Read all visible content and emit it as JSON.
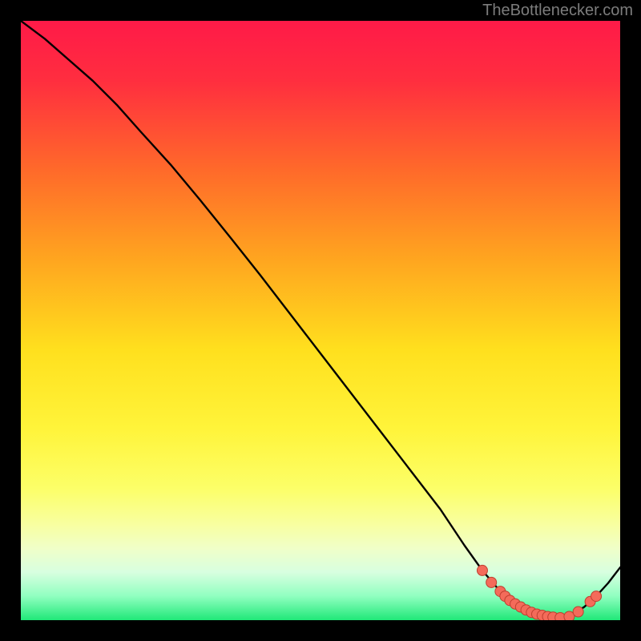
{
  "credit": "TheBottlenecker.com",
  "gradient_stops": [
    {
      "offset": 0,
      "color": "#ff1a48"
    },
    {
      "offset": 0.1,
      "color": "#ff2e3f"
    },
    {
      "offset": 0.25,
      "color": "#ff6a2a"
    },
    {
      "offset": 0.4,
      "color": "#ffa61f"
    },
    {
      "offset": 0.55,
      "color": "#ffe01e"
    },
    {
      "offset": 0.68,
      "color": "#fff43a"
    },
    {
      "offset": 0.78,
      "color": "#fcff68"
    },
    {
      "offset": 0.84,
      "color": "#f8ffa0"
    },
    {
      "offset": 0.88,
      "color": "#f0ffc8"
    },
    {
      "offset": 0.92,
      "color": "#d8ffe0"
    },
    {
      "offset": 0.96,
      "color": "#90ffc0"
    },
    {
      "offset": 1.0,
      "color": "#20e878"
    }
  ],
  "chart_data": {
    "type": "line",
    "title": "",
    "xlabel": "",
    "ylabel": "",
    "xlim": [
      0,
      100
    ],
    "ylim": [
      0,
      100
    ],
    "x": [
      0,
      4,
      8,
      12,
      16,
      20,
      25,
      30,
      35,
      40,
      45,
      50,
      55,
      60,
      65,
      70,
      74,
      77,
      80,
      82,
      84,
      86,
      88,
      90,
      92,
      94,
      96,
      98,
      100
    ],
    "y": [
      100,
      97,
      93.5,
      90,
      86,
      81.5,
      76,
      70,
      63.8,
      57.5,
      51,
      44.5,
      38,
      31.5,
      25,
      18.5,
      12.5,
      8.3,
      4.8,
      2.8,
      1.5,
      0.8,
      0.4,
      0.4,
      1.0,
      2.2,
      4.0,
      6.2,
      8.8
    ],
    "markers_x": [
      77.0,
      78.5,
      80.0,
      80.8,
      81.6,
      82.5,
      83.4,
      84.3,
      85.2,
      86.1,
      87.0,
      87.9,
      88.8,
      90.0,
      91.5,
      93.0,
      95.0,
      96.0
    ],
    "markers_y": [
      8.3,
      6.3,
      4.8,
      4.0,
      3.3,
      2.7,
      2.2,
      1.7,
      1.3,
      1.0,
      0.8,
      0.6,
      0.5,
      0.4,
      0.6,
      1.4,
      3.1,
      4.0
    ],
    "marker_color": "#f46b5a",
    "marker_stroke": "#bf3f2f",
    "line_color": "#000000"
  }
}
